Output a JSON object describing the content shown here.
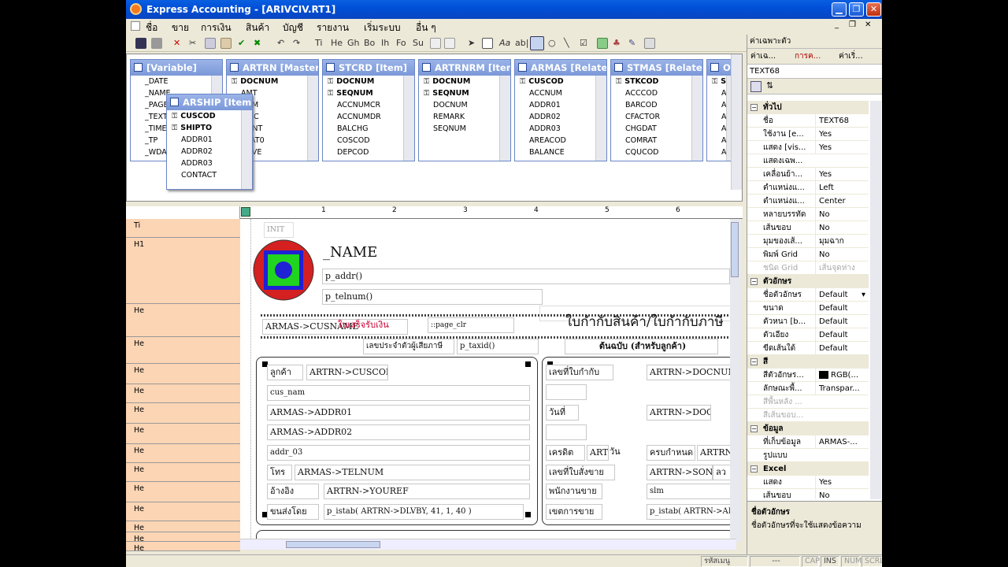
{
  "window": {
    "title": "Express Accounting - [ARIVCIV.RT1]"
  },
  "menu": [
    "ชื่อ",
    "ขาย",
    "การเงิน",
    "สินค้า",
    "บัญชี",
    "รายงาน",
    "เริ่มระบบ",
    "อื่น ๆ"
  ],
  "toolbar": {
    "text_buttons": [
      "Ti",
      "He",
      "Gh",
      "Bo",
      "Ih",
      "Fo",
      "Su"
    ],
    "aa": "Aa",
    "ab": "ab|"
  },
  "tables": [
    {
      "title": "[Variable]",
      "fields": [
        {
          "n": "_DATE"
        },
        {
          "n": "_NAME"
        },
        {
          "n": "_PAGE"
        },
        {
          "n": "_TEXTCO"
        },
        {
          "n": "_TIME"
        },
        {
          "n": "_TP"
        },
        {
          "n": "_WDATE"
        }
      ]
    },
    {
      "title": "ARTRN [Master]",
      "fields": [
        {
          "n": "DOCNUM",
          "k": true
        },
        {
          "n": "AMT"
        },
        {
          "n": "NUM"
        },
        {
          "n": "DISC"
        },
        {
          "n": "OUNT"
        },
        {
          "n": "TRAT0"
        },
        {
          "n": "ROVE"
        }
      ]
    },
    {
      "title": "STCRD [Item]",
      "fields": [
        {
          "n": "DOCNUM",
          "k": true
        },
        {
          "n": "SEQNUM",
          "k": true
        },
        {
          "n": "ACCNUMCR"
        },
        {
          "n": "ACCNUMDR"
        },
        {
          "n": "BALCHG"
        },
        {
          "n": "COSCOD"
        },
        {
          "n": "DEPCOD"
        }
      ]
    },
    {
      "title": "ARTRNRM [Item]",
      "fields": [
        {
          "n": "DOCNUM",
          "k": true
        },
        {
          "n": "SEQNUM",
          "k": true
        },
        {
          "n": "DOCNUM"
        },
        {
          "n": "REMARK"
        },
        {
          "n": "SEQNUM"
        }
      ]
    },
    {
      "title": "ARMAS [Relate]",
      "fields": [
        {
          "n": "CUSCOD",
          "k": true
        },
        {
          "n": "ACCNUM"
        },
        {
          "n": "ADDR01"
        },
        {
          "n": "ADDR02"
        },
        {
          "n": "ADDR03"
        },
        {
          "n": "AREACOD"
        },
        {
          "n": "BALANCE"
        }
      ]
    },
    {
      "title": "STMAS [Relate]",
      "fields": [
        {
          "n": "STKCOD",
          "k": true
        },
        {
          "n": "ACCCOD"
        },
        {
          "n": "BARCOD"
        },
        {
          "n": "CFACTOR"
        },
        {
          "n": "CHGDAT"
        },
        {
          "n": "COMRAT"
        },
        {
          "n": "CQUCOD"
        }
      ]
    },
    {
      "title": "O",
      "fields": [
        {
          "n": "SC",
          "k": true
        },
        {
          "n": "AM"
        },
        {
          "n": "AR"
        },
        {
          "n": "AP"
        },
        {
          "n": "AR"
        },
        {
          "n": "AL"
        },
        {
          "n": "AN"
        }
      ]
    }
  ],
  "popup_table": {
    "title": "ARSHIP [Item]",
    "fields": [
      {
        "n": "CUSCOD",
        "k": true
      },
      {
        "n": "SHIPTO",
        "k": true
      },
      {
        "n": "ADDR01"
      },
      {
        "n": "ADDR02"
      },
      {
        "n": "ADDR03"
      },
      {
        "n": "CONTACT"
      }
    ]
  },
  "ruler_marks": [
    "1",
    "2",
    "3",
    "4",
    "5",
    "6"
  ],
  "bands": [
    "Ti",
    "H1",
    "He",
    "He",
    "He",
    "He",
    "He",
    "He",
    "He",
    "He",
    "He",
    "He",
    "He",
    "He",
    "He"
  ],
  "design": {
    "init": "INIT",
    "name": "_NAME",
    "addr": "p_addr()",
    "tel": "p_telnum()",
    "cusname": "ARMAS->CUSNAME",
    "receipt": "ใบเสร็จรับเงิน",
    "pageclr": "::page_clr",
    "big_title": "ใบกำกับสินค้า/ใบกำกับภาษี",
    "taxid_label": "เลขประจำตัวผู้เสียภาษี",
    "taxid": "p_taxid()",
    "original": "ต้นฉบับ (สำหรับลูกค้า)",
    "customer": "ลูกค้า",
    "cuscod": "ARTRN->CUSCOD",
    "cus_nam": "cus_nam",
    "addr1": "ARMAS->ADDR01",
    "addr2": "ARMAS->ADDR02",
    "addr3": "addr_03",
    "tel_label": "โทร",
    "telnum": "ARMAS->TELNUM",
    "ref_label": "อ้างอิง",
    "youref": "ARTRN->YOUREF",
    "ship_label": "ขนส่งโดย",
    "dlvby": "p_istab( ARTRN->DLVBY, 41, 1, 40 )",
    "inv_label": "เลขที่ใบกำกับ",
    "docnum": "ARTRN->DOCNUM",
    "date_label": "วันที่",
    "docdat": "ARTRN->DOCDAT",
    "credit_label": "เครดิต",
    "credit_val": "ARTI",
    "credit_unit": "วัน",
    "due_label": "ครบกำหนด",
    "due_val": "ARTRN",
    "so_label": "เลขที่ใบสั่งขาย",
    "sonum": "ARTRN->SONUM",
    "sonum2": "ลว",
    "slm_label": "พนักงานขาย",
    "slm": "slm",
    "area_label": "เขตการขาย",
    "area_val": "p_istab( ARTRN->AREA"
  },
  "props": {
    "title": "ค่าเฉพาะตัว",
    "tabs": [
      "ค่าเฉ...",
      "การค...",
      "ค่าเริ่..."
    ],
    "object": "TEXT68",
    "rows": [
      {
        "cat": "ทั่วไป"
      },
      {
        "k": "ชื่อ",
        "v": "TEXT68"
      },
      {
        "k": "ใช้งาน [e...",
        "v": "Yes"
      },
      {
        "k": "แสดง [vis...",
        "v": "Yes"
      },
      {
        "k": "แสดงเฉพ...",
        "v": ""
      },
      {
        "k": "เคลื่อนย้า...",
        "v": "Yes"
      },
      {
        "k": "ตำแหน่งแ...",
        "v": "Left"
      },
      {
        "k": "ตำแหน่งแ...",
        "v": "Center"
      },
      {
        "k": "หลายบรรทัด",
        "v": "No"
      },
      {
        "k": "เส้นขอบ",
        "v": "No"
      },
      {
        "k": "มุมของเส้...",
        "v": "มุมฉาก"
      },
      {
        "k": "พิมพ์ Grid",
        "v": "No"
      },
      {
        "k": "ชนิด Grid",
        "v": "เส้นจุดห่าง",
        "dis": true
      },
      {
        "cat": "ตัวอักษร"
      },
      {
        "k": "ชื่อตัวอักษร",
        "v": "Default",
        "sel": true
      },
      {
        "k": "ขนาด",
        "v": "Default"
      },
      {
        "k": "ตัวหนา [b...",
        "v": "Default"
      },
      {
        "k": "ตัวเอียง",
        "v": "Default"
      },
      {
        "k": "ขีดเส้นใต้",
        "v": "Default"
      },
      {
        "cat": "สี"
      },
      {
        "k": "สีตัวอักษร...",
        "v": "RGB(...",
        "sw": true
      },
      {
        "k": "ลักษณะพื้...",
        "v": "Transpar..."
      },
      {
        "k": "สีพื้นหลัง ...",
        "v": "",
        "dis": true
      },
      {
        "k": "สีเส้นขอบ...",
        "v": "",
        "dis": true
      },
      {
        "cat": "ข้อมูล"
      },
      {
        "k": "ที่เก็บข้อมูล",
        "v": "ARMAS-..."
      },
      {
        "k": "รูปแบบ",
        "v": ""
      },
      {
        "cat": "Excel"
      },
      {
        "k": "แสดง",
        "v": "Yes"
      },
      {
        "k": "เส้นขอบ",
        "v": "No"
      }
    ],
    "desc_title": "ชื่อตัวอักษร",
    "desc_text": "ชื่อตัวอักษรที่จะใช้แสดงข้อความ"
  },
  "status": {
    "label": "รหัสเมนู",
    "code": "---",
    "cap": "CAP",
    "ins": "INS",
    "num": "NUM",
    "scrl": "SCRL"
  }
}
